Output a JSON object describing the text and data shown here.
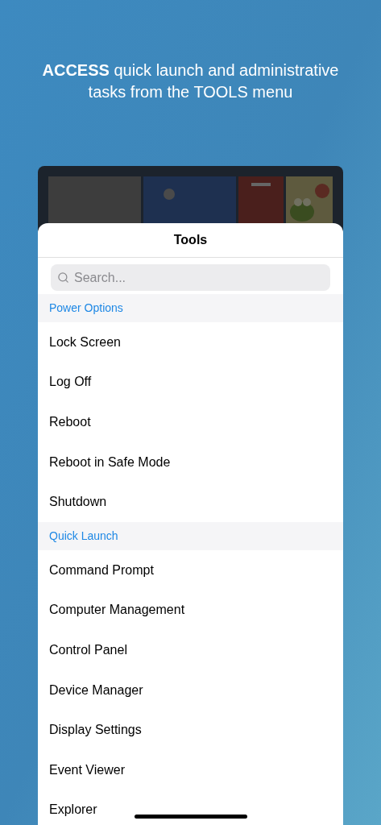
{
  "headline": "**ACCESS** quick launch and administrative tasks from the TOOLS menu",
  "sheet": {
    "title": "Tools",
    "search": {
      "placeholder": "Search..."
    },
    "sections": [
      {
        "title": "Power Options",
        "items": [
          "Lock Screen",
          "Log Off",
          "Reboot",
          "Reboot in Safe Mode",
          "Shutdown"
        ]
      },
      {
        "title": "Quick Launch",
        "items": [
          "Command Prompt",
          "Computer Management",
          "Control Panel",
          "Device Manager",
          "Display Settings",
          "Event Viewer",
          "Explorer"
        ]
      }
    ]
  }
}
